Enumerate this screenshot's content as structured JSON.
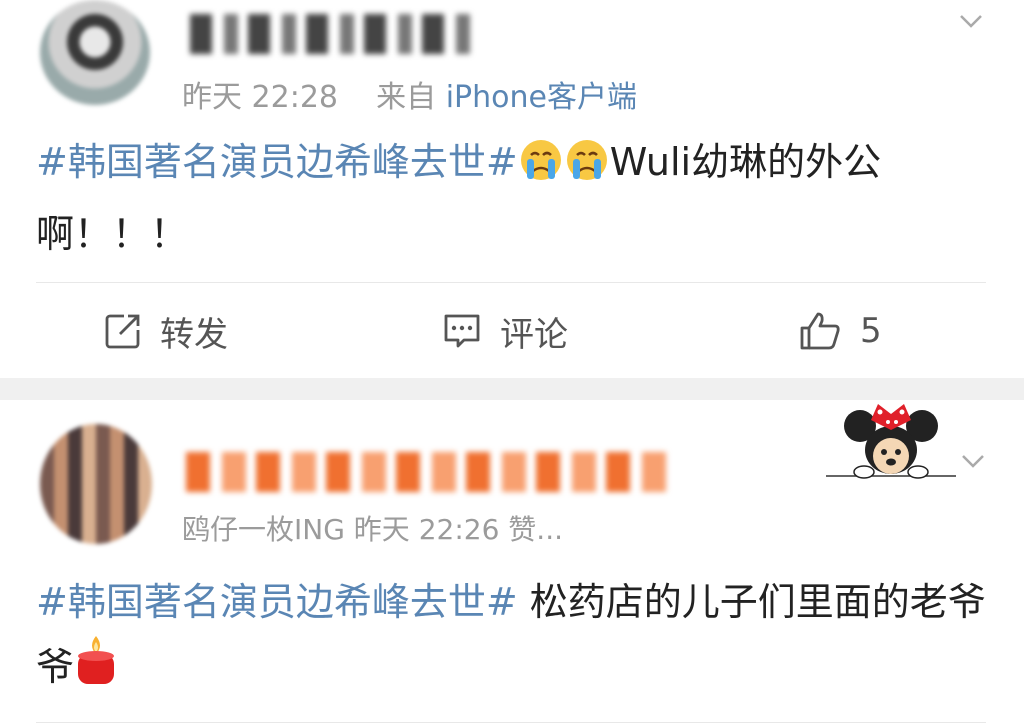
{
  "post1": {
    "username": "",
    "timestamp": "昨天 22:28",
    "source_prefix": "来自",
    "source": "iPhone客户端",
    "topic": "#韩国著名演员边希峰去世#",
    "text": "Wuli幼琳的外公啊！！！",
    "emojis": [
      "crying-emoji",
      "crying-emoji"
    ],
    "actions": {
      "repost_label": "转发",
      "comment_label": "评论",
      "like_count": "5"
    }
  },
  "post2": {
    "username": "",
    "meta": "鸥仔一枚ING 昨天 22:26 赞...",
    "topic": "#韩国著名演员边希峰去世#",
    "text": " 松药店的儿子们里面的老爷爷",
    "emojis": [
      "candle-emoji"
    ],
    "sticker": "minnie-mouse-sticker"
  },
  "colors": {
    "link": "#5a86b4",
    "meta": "#9b9b9b",
    "text": "#222222",
    "divider": "#f0f0f0"
  }
}
